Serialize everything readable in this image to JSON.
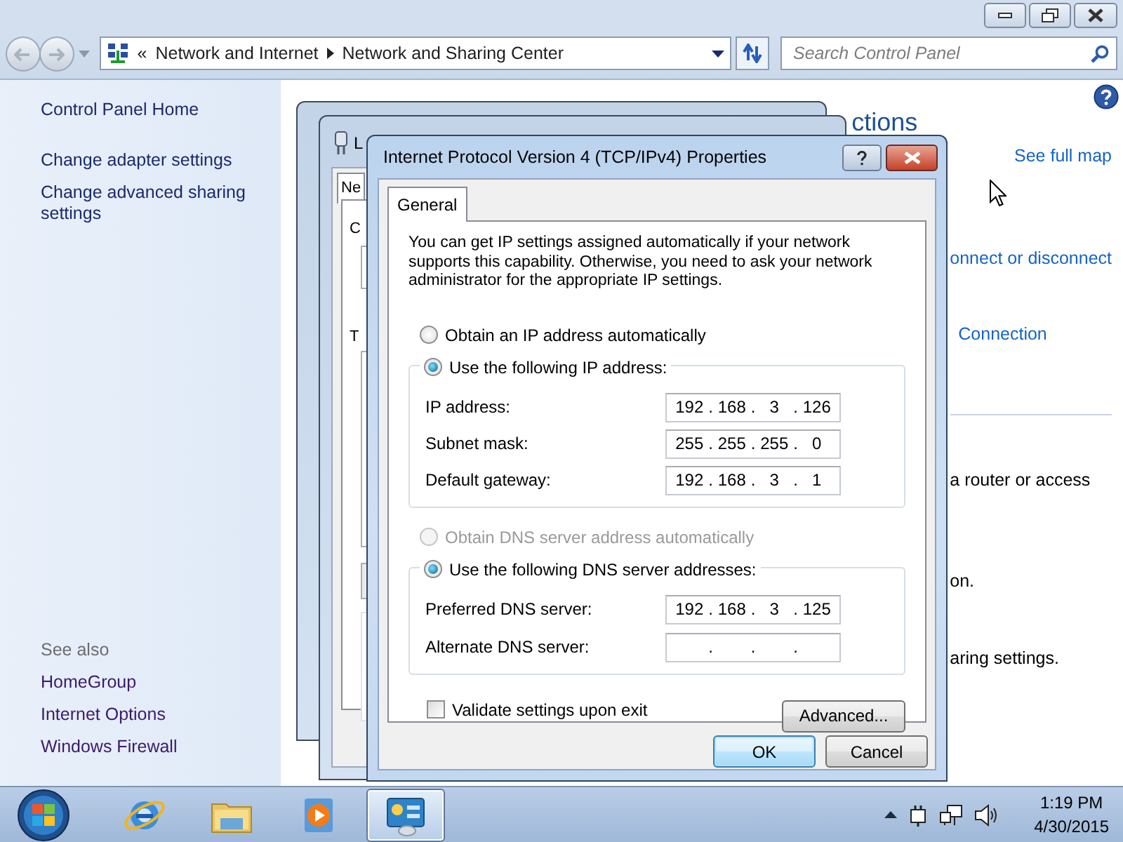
{
  "address_bar": {
    "overflow": "«",
    "path": [
      "Network and Internet",
      "Network and Sharing Center"
    ]
  },
  "search": {
    "placeholder": "Search Control Panel"
  },
  "sidebar": {
    "links": [
      "Control Panel Home",
      "Change adapter settings",
      "Change advanced sharing settings"
    ],
    "see_also_heading": "See also",
    "see_also": [
      "HomeGroup",
      "Internet Options",
      "Windows Firewall"
    ]
  },
  "main_fragments": [
    {
      "kind": "heading",
      "text": "ctions"
    },
    {
      "kind": "link",
      "text": "See full map"
    },
    {
      "kind": "link",
      "text": "onnect or disconnect"
    },
    {
      "kind": "link",
      "text": "Connection"
    },
    {
      "kind": "text",
      "text": "a router or access"
    },
    {
      "kind": "text",
      "text": "on."
    },
    {
      "kind": "text",
      "text": "aring settings."
    }
  ],
  "background_windows": [
    {
      "kind": "blank"
    },
    {
      "kind": "properties",
      "title": "L",
      "tab": "Ne",
      "labels": [
        "C",
        "T"
      ]
    }
  ],
  "dialog": {
    "title": "Internet Protocol Version 4 (TCP/IPv4) Properties",
    "tabs": [
      {
        "label": "General",
        "selected": true
      }
    ],
    "intro": "You can get IP settings assigned automatically if your network supports this capability. Otherwise, you need to ask your network administrator for the appropriate IP settings.",
    "ip_mode": [
      {
        "label": "Obtain an IP address automatically",
        "selected": false,
        "disabled": false
      },
      {
        "label": "Use the following IP address:",
        "selected": true,
        "disabled": false
      }
    ],
    "ip_fields": [
      {
        "label": "IP address:",
        "octets": [
          "192",
          "168",
          "3",
          "126"
        ]
      },
      {
        "label": "Subnet mask:",
        "octets": [
          "255",
          "255",
          "255",
          "0"
        ]
      },
      {
        "label": "Default gateway:",
        "octets": [
          "192",
          "168",
          "3",
          "1"
        ]
      }
    ],
    "dns_mode": [
      {
        "label": "Obtain DNS server address automatically",
        "selected": false,
        "disabled": true
      },
      {
        "label": "Use the following DNS server addresses:",
        "selected": true,
        "disabled": false
      }
    ],
    "dns_fields": [
      {
        "label": "Preferred DNS server:",
        "octets": [
          "192",
          "168",
          "3",
          "125"
        ]
      },
      {
        "label": "Alternate DNS server:"
      }
    ],
    "separator": ".",
    "validate": {
      "label": "Validate settings upon exit",
      "checked": false
    },
    "advanced_button": "Advanced...",
    "footer_buttons": [
      {
        "label": "OK",
        "default": true
      },
      {
        "label": "Cancel",
        "default": false
      }
    ]
  },
  "taskbar": {
    "apps": [
      {
        "kind": "browser",
        "selected": false
      },
      {
        "kind": "folders",
        "selected": false
      },
      {
        "kind": "media",
        "selected": false
      },
      {
        "kind": "control-panel",
        "selected": true
      }
    ],
    "clock": {
      "time": "1:19 PM",
      "date": "4/30/2015"
    }
  }
}
